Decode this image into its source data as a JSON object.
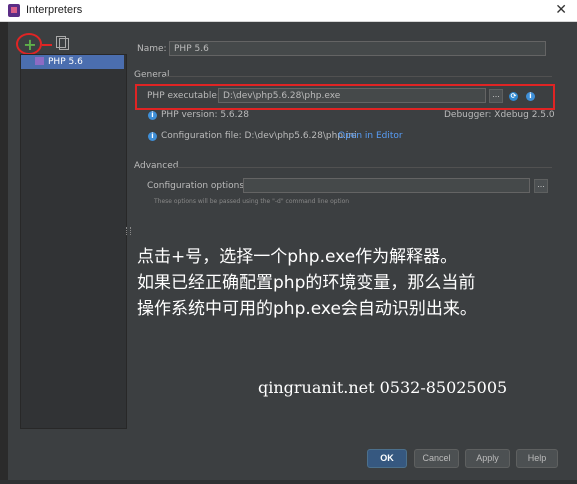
{
  "window": {
    "title": "Interpreters",
    "close_glyph": "✕"
  },
  "sidebar": {
    "add_glyph": "+",
    "items": [
      {
        "label": "PHP 5.6"
      }
    ]
  },
  "form": {
    "name_label": "Name:",
    "name_value": "PHP 5.6",
    "general_section": "General",
    "php_executable_label": "PHP executable:",
    "php_executable_value": "D:\\dev\\php5.6.28\\php.exe",
    "browse_label": "...",
    "php_version_text": "PHP version: 5.6.28",
    "debugger_text": "Debugger: Xdebug 2.5.0",
    "config_file_text": "Configuration file: D:\\dev\\php5.6.28\\php.ini",
    "open_in_editor": "Open in Editor",
    "advanced_section": "Advanced",
    "config_options_label": "Configuration options:",
    "config_options_value": "",
    "hint": "These options will be passed using the \"-d\" command line option"
  },
  "annotation": {
    "lines": [
      "点击+号，选择一个php.exe作为解释器。",
      "如果已经正确配置php的环境变量，那么当前",
      "操作系统中可用的php.exe会自动识别出来。"
    ],
    "watermark": "qingruanit.net 0532-85025005"
  },
  "buttons": {
    "ok": "OK",
    "cancel": "Cancel",
    "apply": "Apply",
    "help": "Help"
  },
  "colors": {
    "accent": "#4b6eaf",
    "highlight": "#e02424",
    "link": "#589df6",
    "add": "#5fb04a"
  }
}
